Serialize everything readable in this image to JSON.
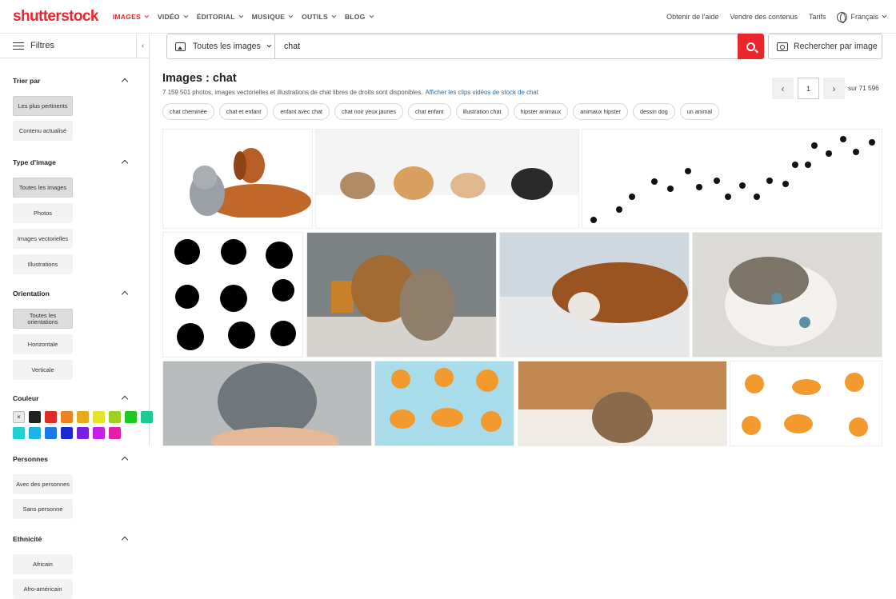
{
  "brand": {
    "logo_text": "shutterstock"
  },
  "nav": {
    "items": [
      {
        "label": "IMAGES",
        "active": true
      },
      {
        "label": "VIDÉO",
        "active": false
      },
      {
        "label": "ÉDITORIAL",
        "active": false
      },
      {
        "label": "MUSIQUE",
        "active": false
      },
      {
        "label": "OUTILS",
        "active": false
      },
      {
        "label": "BLOG",
        "active": false
      }
    ],
    "help": "Obtenir de l'aide",
    "sell": "Vendre des contenus",
    "pricing": "Tarifs",
    "language": "Français"
  },
  "sidebar": {
    "filters_label": "Filtres",
    "sort": {
      "title": "Trier par",
      "options": [
        "Les plus pertinents",
        "Contenu actualisé"
      ],
      "selected": 0
    },
    "image_type": {
      "title": "Type d'image",
      "options": [
        "Toutes les images",
        "Photos",
        "Images vectorielles",
        "Illustrations"
      ],
      "selected": 0
    },
    "orientation": {
      "title": "Orientation",
      "options": [
        "Toutes les orientations",
        "Horizontale",
        "Verticale"
      ],
      "selected": 0
    },
    "color": {
      "title": "Couleur",
      "swatches": [
        "#e9e9e9",
        "#222222",
        "#e02a2a",
        "#f0821e",
        "#e8a91c",
        "#e6e42a",
        "#9ad21e",
        "#1ec81e",
        "#1ec895",
        "#1ed2d2",
        "#1eb4e6",
        "#1e78e6",
        "#1e28d2",
        "#7a1ee6",
        "#c81ee6",
        "#e61eaa"
      ]
    },
    "people": {
      "title": "Personnes",
      "options": [
        "Avec des personnes",
        "Sans personne"
      ]
    },
    "ethnicity": {
      "title": "Ethnicité",
      "options": [
        "Africain",
        "Afro-américain"
      ]
    }
  },
  "search": {
    "type_label": "Toutes les images",
    "query": "chat",
    "by_image_label": "Rechercher par image"
  },
  "results": {
    "title": "Images : chat",
    "subtitle": "7 159 501 photos, images vectorielles et illustrations de chat libres de droits sont disponibles.",
    "video_link": "Afficher les clips vidéos de stock de chat",
    "page": "1",
    "page_of": "sur 71 596"
  },
  "chips": [
    "chat cheminée",
    "chat et enfant",
    "enfant avec chat",
    "chat noir yeux jaunes",
    "chat enfant",
    "illustration chat",
    "hipster animaux",
    "animaux hipster",
    "dessin dog",
    "un animal"
  ],
  "images": [
    {
      "name": "cat-and-dog-lying",
      "bg": "#ffffff"
    },
    {
      "name": "pets-peeking-banner",
      "bg": "#f4f4f4"
    },
    {
      "name": "paw-prints-trail",
      "bg": "#ffffff"
    },
    {
      "name": "black-cat-silhouettes",
      "bg": "#ffffff"
    },
    {
      "name": "shepherd-dog-and-cat",
      "bg": "#8a8e8f"
    },
    {
      "name": "dog-and-kitten-floor",
      "bg": "#c8d2d8"
    },
    {
      "name": "kitten-lying-closeup",
      "bg": "#dcdad6"
    },
    {
      "name": "grey-cat-hand",
      "bg": "#b9bcbd"
    },
    {
      "name": "cartoon-orange-cats-blue",
      "bg": "#a8dcea"
    },
    {
      "name": "tabby-cat-bed",
      "bg": "#c79b6a"
    },
    {
      "name": "cartoon-orange-cats-white",
      "bg": "#ffffff"
    }
  ]
}
